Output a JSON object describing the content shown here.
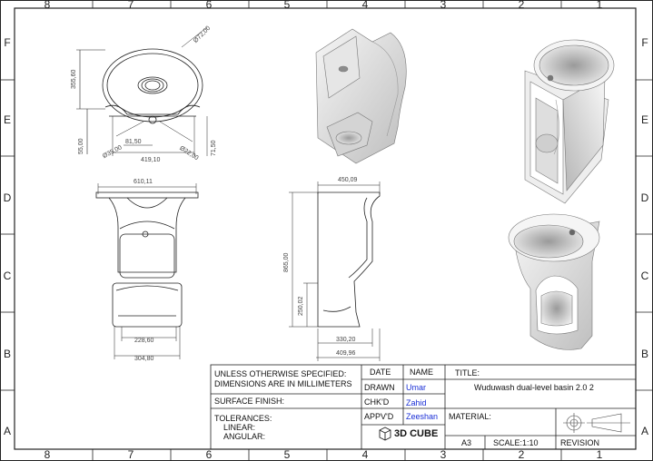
{
  "border": {
    "columns": [
      "8",
      "7",
      "6",
      "5",
      "4",
      "3",
      "2",
      "1"
    ],
    "rows": [
      "F",
      "E",
      "D",
      "C",
      "B",
      "A"
    ]
  },
  "dimensions": {
    "top_diameter": "Ø72,00",
    "top_height": "355,60",
    "small_height": "55,00",
    "hole_diameter": "Ø35,00",
    "offset": "81,50",
    "width_top": "419,10",
    "drain_diameter": "Ø22,00",
    "drain_offset": "71,50",
    "front_width": "610,11",
    "front_inner": "228,60",
    "front_base": "304,80",
    "side_top": "450,09",
    "side_height": "865,00",
    "side_low": "250,02",
    "side_base_inner": "330,20",
    "side_base": "409,96"
  },
  "title_block": {
    "unless_line1": "UNLESS OTHERWISE SPECIFIED:",
    "unless_line2": "DIMENSIONS ARE IN MILLIMETERS",
    "surface_finish": "SURFACE FINISH:",
    "tolerances": "TOLERANCES:",
    "linear": "LINEAR:",
    "angular": "ANGULAR:",
    "col_date": "DATE",
    "col_name": "NAME",
    "drawn_label": "DRAWN",
    "drawn_name": "Umar",
    "chkd_label": "CHK'D",
    "chkd_name": "Zahid",
    "apprd_label": "APPV'D",
    "apprd_name": "Zeeshan",
    "logo_text": "3D CUBE",
    "title_label": "TITLE:",
    "title_value": "Wuduwash dual-level basin 2.0 2",
    "material_label": "MATERIAL:",
    "sheet_size": "A3",
    "scale": "SCALE:1:10",
    "revision": "REVISION"
  },
  "colors": {
    "line": "#222222",
    "name_blue": "#1a2fd6",
    "shade_light": "#f3f3f3",
    "shade_mid": "#d9d9d9",
    "shade_dark": "#a9a9a9"
  }
}
